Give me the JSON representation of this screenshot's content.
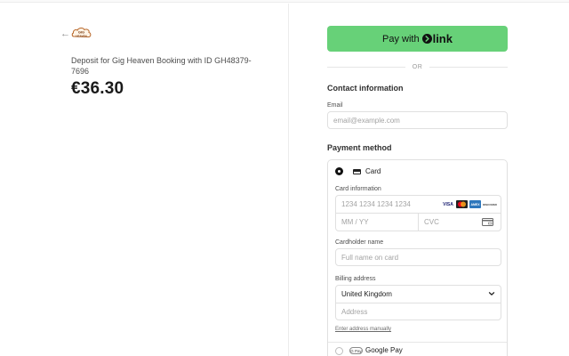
{
  "merchant": {
    "back_arrow": "←",
    "logo_text_top": "GIG",
    "logo_text_bottom": "HEAVEN",
    "description": "Deposit for Gig Heaven Booking with ID GH48379-7696",
    "amount": "€36.30"
  },
  "link_button": {
    "prefix": "Pay with",
    "brand": "link",
    "color": "#67d178"
  },
  "divider_or": "OR",
  "contact": {
    "heading": "Contact information",
    "email_label": "Email",
    "email_placeholder": "email@example.com"
  },
  "payment": {
    "heading": "Payment method",
    "card": {
      "label": "Card",
      "selected": true,
      "info_label": "Card information",
      "number_placeholder": "1234 1234 1234 1234",
      "expiry_placeholder": "MM / YY",
      "cvc_placeholder": "CVC",
      "brands": [
        "VISA",
        "MC",
        "AMEX",
        "DISCOVER"
      ],
      "holder_label": "Cardholder name",
      "holder_placeholder": "Full name on card",
      "billing_label": "Billing address",
      "country": "United Kingdom",
      "address_placeholder": "Address",
      "manual_link": "Enter address manually"
    },
    "google_pay": {
      "badge": "G Pay",
      "label": "Google Pay",
      "selected": false
    }
  }
}
